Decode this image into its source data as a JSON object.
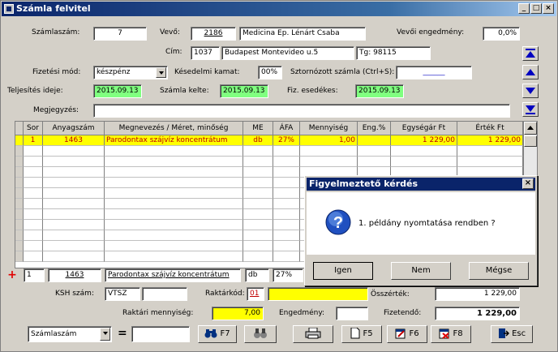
{
  "window": {
    "title": "Számla felvitel"
  },
  "titlebar_buttons": [
    "_",
    "□",
    "×"
  ],
  "header": {
    "szamlaszam_label": "Számlaszám:",
    "szamlaszam": "7",
    "vevo_label": "Vevő:",
    "vevo_code": "2186",
    "vevo_name": "Medicina Ep. Lénárt Csaba",
    "vevoi_engedmeny_label": "Vevői engedmény:",
    "vevoi_engedmeny": "0,0%",
    "cim_label": "Cím:",
    "irsz": "1037",
    "cim": "Budapest Montevideo u.5",
    "tel": "Tg: 98115",
    "fizetesi_mod_label": "Fizetési mód:",
    "fizetesi_mod": "készpénz",
    "kesedelmi_kamat_label": "Késedelmi kamat:",
    "kesedelmi_kamat": "00%",
    "sztornozott_label": "Sztornózott számla (Ctrl+S):",
    "sztornozott": "______",
    "teljesites_label": "Teljesítés ideje:",
    "teljesites": "2015.09.13",
    "szamla_kelte_label": "Számla kelte:",
    "szamla_kelte": "2015.09.13",
    "fiz_esedekes_label": "Fiz. esedékes:",
    "fiz_esedekes": "2015.09.13",
    "megjegyzes_label": "Megjegyzés:",
    "megjegyzes": ""
  },
  "table": {
    "columns": [
      "Sor",
      "Anyagszám",
      "Megnevezés / Méret, minőség",
      "ME",
      "ÁFA",
      "Mennyiség",
      "Eng.%",
      "Egységár Ft",
      "Érték Ft"
    ],
    "rows": [
      [
        "1",
        "1463",
        "Parodontax szájvíz koncentrátum",
        "db",
        "27%",
        "1,00",
        "",
        "1 229,00",
        "1 229,00"
      ]
    ]
  },
  "edit_row": {
    "sor": "1",
    "anyagszam": "1463",
    "megnevezes": "Parodontax szájvíz koncentrátum",
    "me": "db",
    "afa": "27%"
  },
  "bottom": {
    "ksh_label": "KSH szám:",
    "ksh": "VTSZ",
    "raktarkod_label": "Raktárkód:",
    "raktarkod": "01",
    "osszertek_label": "Összérték:",
    "osszertek": "1 229,00",
    "raktari_menny_label": "Raktári mennyiség:",
    "raktari_menny": "7,00",
    "engedmeny_label": "Engedmény:",
    "engedmeny": "",
    "fizetendo_label": "Fizetendő:",
    "fizetendo": "1 229,00",
    "search_field": "Számlaszám",
    "equals": "="
  },
  "toolbar": {
    "f7": "F7",
    "f5": "F5",
    "f6": "F6",
    "f8": "F8",
    "esc": "Esc"
  },
  "dialog": {
    "title": "Figyelmeztető kérdés",
    "message": "1. példány nyomtatása rendben ?",
    "yes": "Igen",
    "no": "Nem",
    "cancel": "Mégse"
  },
  "colors": {
    "title_bar": "#0a246a",
    "row_highlight": "#ffff00",
    "date_field": "#80ff80",
    "text_red": "#c00000"
  }
}
